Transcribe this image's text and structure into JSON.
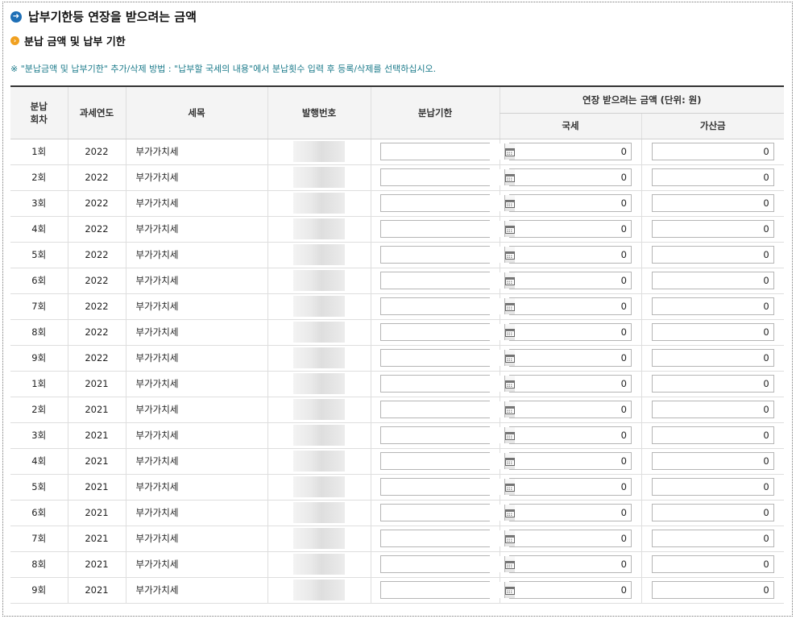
{
  "title": "납부기한등 연장을 받으려는 금액",
  "subtitle": "분납 금액 및 납부 기한",
  "note": "※ \"분납금액 및 납부기한\" 추가/삭제 방법 : \"납부할 국세의 내용\"에서 분납횟수 입력 후 등록/삭제를 선택하십시오.",
  "icons": {
    "title_icon": "arrow-right-circle-icon",
    "subtitle_icon": "bullet-circle-icon",
    "date_button_icon": "calendar-icon"
  },
  "colors": {
    "title_icon": "#1e6fb6",
    "subtitle_icon": "#f0a020",
    "note_text": "#1a7a8a"
  },
  "table": {
    "headers": {
      "installment": "분납\n회차",
      "tax_year": "과세연도",
      "tax_item": "세목",
      "issue_no": "발행번호",
      "due_date": "분납기한",
      "amount_group": "연장 받으려는 금액 (단위: 원)",
      "national_tax": "국세",
      "surcharge": "가산금"
    },
    "rows": [
      {
        "installment": "1회",
        "tax_year": "2022",
        "tax_item": "부가가치세",
        "due_date": "",
        "national_tax": "0",
        "surcharge": "0"
      },
      {
        "installment": "2회",
        "tax_year": "2022",
        "tax_item": "부가가치세",
        "due_date": "",
        "national_tax": "0",
        "surcharge": "0"
      },
      {
        "installment": "3회",
        "tax_year": "2022",
        "tax_item": "부가가치세",
        "due_date": "",
        "national_tax": "0",
        "surcharge": "0"
      },
      {
        "installment": "4회",
        "tax_year": "2022",
        "tax_item": "부가가치세",
        "due_date": "",
        "national_tax": "0",
        "surcharge": "0"
      },
      {
        "installment": "5회",
        "tax_year": "2022",
        "tax_item": "부가가치세",
        "due_date": "",
        "national_tax": "0",
        "surcharge": "0"
      },
      {
        "installment": "6회",
        "tax_year": "2022",
        "tax_item": "부가가치세",
        "due_date": "",
        "national_tax": "0",
        "surcharge": "0"
      },
      {
        "installment": "7회",
        "tax_year": "2022",
        "tax_item": "부가가치세",
        "due_date": "",
        "national_tax": "0",
        "surcharge": "0"
      },
      {
        "installment": "8회",
        "tax_year": "2022",
        "tax_item": "부가가치세",
        "due_date": "",
        "national_tax": "0",
        "surcharge": "0"
      },
      {
        "installment": "9회",
        "tax_year": "2022",
        "tax_item": "부가가치세",
        "due_date": "",
        "national_tax": "0",
        "surcharge": "0"
      },
      {
        "installment": "1회",
        "tax_year": "2021",
        "tax_item": "부가가치세",
        "due_date": "",
        "national_tax": "0",
        "surcharge": "0"
      },
      {
        "installment": "2회",
        "tax_year": "2021",
        "tax_item": "부가가치세",
        "due_date": "",
        "national_tax": "0",
        "surcharge": "0"
      },
      {
        "installment": "3회",
        "tax_year": "2021",
        "tax_item": "부가가치세",
        "due_date": "",
        "national_tax": "0",
        "surcharge": "0"
      },
      {
        "installment": "4회",
        "tax_year": "2021",
        "tax_item": "부가가치세",
        "due_date": "",
        "national_tax": "0",
        "surcharge": "0"
      },
      {
        "installment": "5회",
        "tax_year": "2021",
        "tax_item": "부가가치세",
        "due_date": "",
        "national_tax": "0",
        "surcharge": "0"
      },
      {
        "installment": "6회",
        "tax_year": "2021",
        "tax_item": "부가가치세",
        "due_date": "",
        "national_tax": "0",
        "surcharge": "0"
      },
      {
        "installment": "7회",
        "tax_year": "2021",
        "tax_item": "부가가치세",
        "due_date": "",
        "national_tax": "0",
        "surcharge": "0"
      },
      {
        "installment": "8회",
        "tax_year": "2021",
        "tax_item": "부가가치세",
        "due_date": "",
        "national_tax": "0",
        "surcharge": "0"
      },
      {
        "installment": "9회",
        "tax_year": "2021",
        "tax_item": "부가가치세",
        "due_date": "",
        "national_tax": "0",
        "surcharge": "0"
      }
    ]
  }
}
